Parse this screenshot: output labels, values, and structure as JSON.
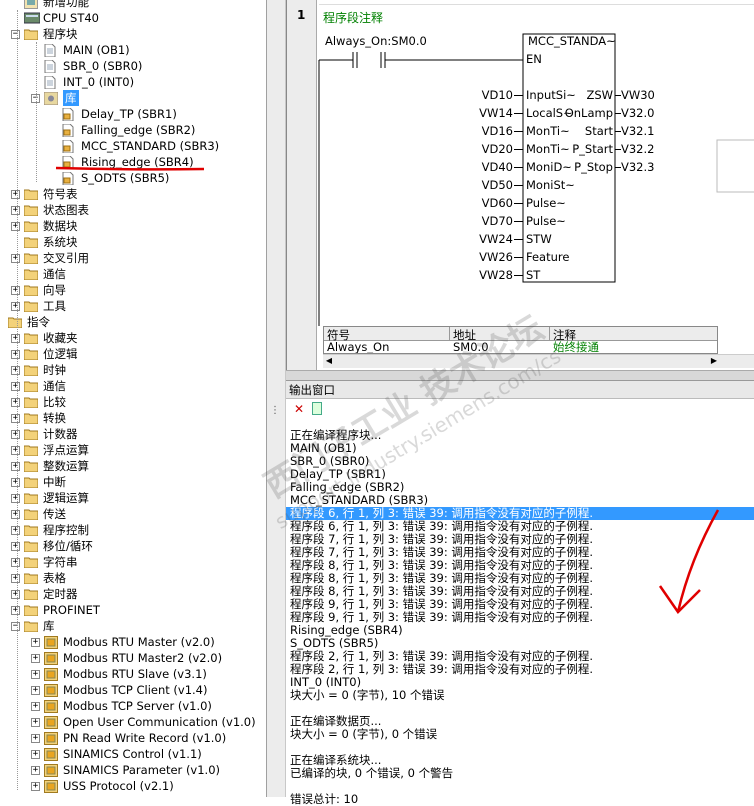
{
  "tree": {
    "top_item": "新增功能",
    "cpu": "CPU ST40",
    "program_block": "程序块",
    "blocks": [
      "MAIN (OB1)",
      "SBR_0 (SBR0)",
      "INT_0 (INT0)"
    ],
    "lib": "库",
    "lib_items": [
      "Delay_TP (SBR1)",
      "Falling_edge (SBR2)",
      "MCC_STANDARD (SBR3)",
      "Rising_edge (SBR4)",
      "S_ODTS (SBR5)"
    ],
    "project_items": [
      "符号表",
      "状态图表",
      "数据块",
      "系统块",
      "交叉引用",
      "通信",
      "向导",
      "工具"
    ],
    "instructions": "指令",
    "instr_items": [
      "收藏夹",
      "位逻辑",
      "时钟",
      "通信",
      "比较",
      "转换",
      "计数器",
      "浮点运算",
      "整数运算",
      "中断",
      "逻辑运算",
      "传送",
      "程序控制",
      "移位/循环",
      "字符串",
      "表格",
      "定时器",
      "PROFINET"
    ],
    "library": "库",
    "libraries": [
      "Modbus RTU Master (v2.0)",
      "Modbus RTU Master2 (v2.0)",
      "Modbus RTU Slave (v3.1)",
      "Modbus TCP Client (v1.4)",
      "Modbus TCP Server (v1.0)",
      "Open User Communication (v1.0)",
      "PN Read Write Record (v1.0)",
      "SINAMICS Control (v1.1)",
      "SINAMICS Parameter (v1.0)",
      "USS Protocol (v2.1)"
    ]
  },
  "editor": {
    "network_no": "1",
    "network_comment": "程序段注释",
    "contact": "Always_On:SM0.0",
    "block_name": "MCC_STANDA~",
    "en": "EN",
    "inputs": [
      {
        "v": "VD10",
        "p": "InputSi~"
      },
      {
        "v": "VW14",
        "p": "LocalS~"
      },
      {
        "v": "VD16",
        "p": "MonTi~"
      },
      {
        "v": "VD20",
        "p": "MonTi~"
      },
      {
        "v": "VD40",
        "p": "MoniD~"
      },
      {
        "v": "VD50",
        "p": "MoniSt~"
      },
      {
        "v": "VD60",
        "p": "Pulse~"
      },
      {
        "v": "VD70",
        "p": "Pulse~"
      },
      {
        "v": "VW24",
        "p": "STW"
      },
      {
        "v": "VW26",
        "p": "Feature"
      },
      {
        "v": "VW28",
        "p": "ST"
      }
    ],
    "outputs": [
      {
        "p": "ZSW",
        "v": "VW30"
      },
      {
        "p": "OnLamp",
        "v": "V32.0"
      },
      {
        "p": "Start",
        "v": "V32.1"
      },
      {
        "p": "P_Start",
        "v": "V32.2"
      },
      {
        "p": "P_Stop",
        "v": "V32.3"
      }
    ],
    "sym_headers": [
      "符号",
      "地址",
      "注释"
    ],
    "sym_row": [
      "Always_On",
      "SM0.0",
      "始终接通"
    ]
  },
  "output": {
    "title": "输出窗口",
    "lines": [
      "正在编译程序块...",
      "MAIN (OB1)",
      "SBR_0 (SBR0)",
      "Delay_TP (SBR1)",
      "Falling_edge (SBR2)",
      "MCC_STANDARD (SBR3)",
      "程序段 6, 行 1, 列 3: 错误 39: 调用指令没有对应的子例程.",
      "程序段 6, 行 1, 列 3: 错误 39: 调用指令没有对应的子例程.",
      "程序段 7, 行 1, 列 3: 错误 39: 调用指令没有对应的子例程.",
      "程序段 7, 行 1, 列 3: 错误 39: 调用指令没有对应的子例程.",
      "程序段 8, 行 1, 列 3: 错误 39: 调用指令没有对应的子例程.",
      "程序段 8, 行 1, 列 3: 错误 39: 调用指令没有对应的子例程.",
      "程序段 8, 行 1, 列 3: 错误 39: 调用指令没有对应的子例程.",
      "程序段 9, 行 1, 列 3: 错误 39: 调用指令没有对应的子例程.",
      "程序段 9, 行 1, 列 3: 错误 39: 调用指令没有对应的子例程.",
      "Rising_edge (SBR4)",
      "S_ODTS (SBR5)",
      "程序段 2, 行 1, 列 3: 错误 39: 调用指令没有对应的子例程.",
      "程序段 2, 行 1, 列 3: 错误 39: 调用指令没有对应的子例程.",
      "INT_0 (INT0)",
      "块大小 = 0 (字节), 10 个错误",
      "",
      "正在编译数据页...",
      "块大小 = 0 (字节), 0 个错误",
      "",
      "正在编译系统块...",
      "已编译的块, 0 个错误, 0 个警告",
      "",
      "错误总计: 10"
    ],
    "selected_index": 6
  },
  "watermark": "西门子工业 技术论坛",
  "watermark_url": "support.industry.siemens.com/cs",
  "colors": {
    "highlight": "#3399ff",
    "annotation": "#e00000",
    "tree_selected": "#3399ff"
  }
}
